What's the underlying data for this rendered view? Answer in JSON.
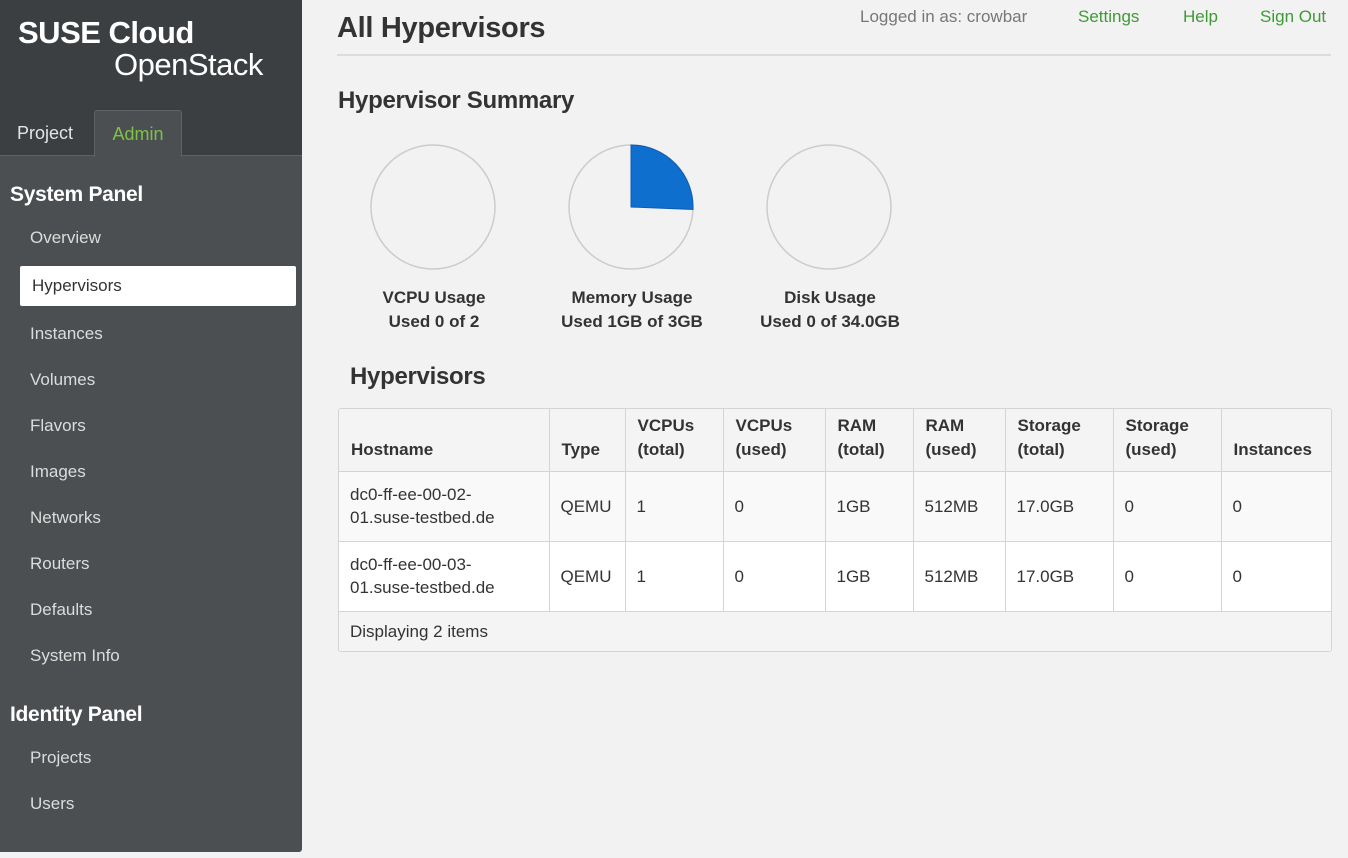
{
  "brand": {
    "line1": "SUSE Cloud",
    "line2": "OpenStack"
  },
  "tabs": [
    {
      "label": "Project"
    },
    {
      "label": "Admin",
      "active": true
    }
  ],
  "system_panel": {
    "title": "System Panel",
    "items": [
      "Overview",
      "Hypervisors",
      "Instances",
      "Volumes",
      "Flavors",
      "Images",
      "Networks",
      "Routers",
      "Defaults",
      "System Info"
    ],
    "active": "Hypervisors"
  },
  "identity_panel": {
    "title": "Identity Panel",
    "items": [
      "Projects",
      "Users"
    ]
  },
  "header": {
    "title": "All Hypervisors",
    "logged_in": "Logged in as: crowbar",
    "links": [
      "Settings",
      "Help",
      "Sign Out"
    ]
  },
  "summary": {
    "title": "Hypervisor Summary",
    "charts": [
      {
        "label": "VCPU Usage",
        "detail": "Used 0 of 2",
        "used": 0,
        "total": 2
      },
      {
        "label": "Memory Usage",
        "detail": "Used 1GB of 3GB",
        "used": 1,
        "total": 3.9
      },
      {
        "label": "Disk Usage",
        "detail": "Used 0 of 34.0GB",
        "used": 0,
        "total": 34.0
      }
    ]
  },
  "hypervisors": {
    "title": "Hypervisors",
    "columns": [
      [
        "Hostname"
      ],
      [
        "Type"
      ],
      [
        "VCPUs",
        "(total)"
      ],
      [
        "VCPUs",
        "(used)"
      ],
      [
        "RAM",
        "(total)"
      ],
      [
        "RAM",
        "(used)"
      ],
      [
        "Storage",
        "(total)"
      ],
      [
        "Storage",
        "(used)"
      ],
      [
        "Instances"
      ]
    ],
    "rows": [
      [
        [
          "dc0-ff-ee-00-02-",
          "01.suse-testbed.de"
        ],
        "QEMU",
        "1",
        "0",
        "1GB",
        "512MB",
        "17.0GB",
        "0",
        "0"
      ],
      [
        [
          "dc0-ff-ee-00-03-",
          "01.suse-testbed.de"
        ],
        "QEMU",
        "1",
        "0",
        "1GB",
        "512MB",
        "17.0GB",
        "0",
        "0"
      ]
    ],
    "footer": "Displaying 2 items"
  },
  "colors": {
    "accent_green": "#3f9a35",
    "pie_fill": "#f2f2f2",
    "pie_used": "#0f6fcf",
    "pie_stroke": "#cccccc"
  }
}
